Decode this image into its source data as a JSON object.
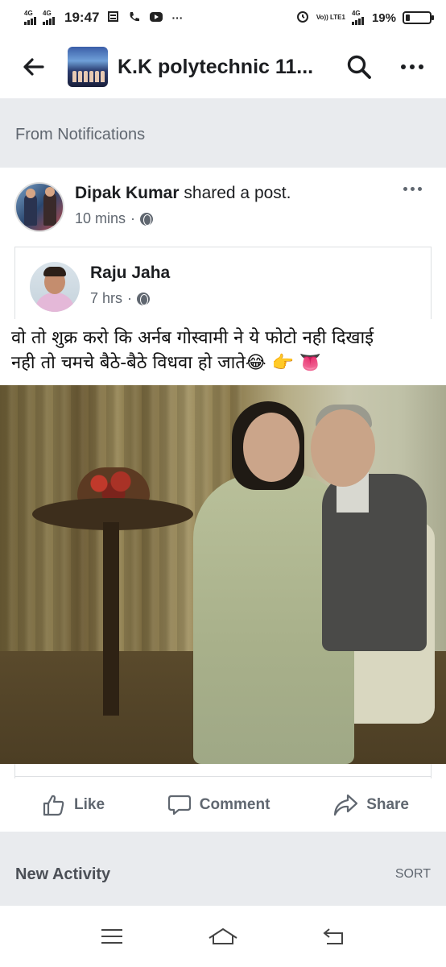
{
  "status_bar": {
    "network_1": "4G",
    "network_2": "4G",
    "time": "19:47",
    "volte": "Vo)) LTE1",
    "network_right": "4G",
    "battery": "19%",
    "battery_level": 0.19
  },
  "header": {
    "title": "K.K polytechnic 11..."
  },
  "notifications": {
    "label": "From Notifications"
  },
  "post": {
    "sharer_name": "Dipak Kumar",
    "action_text": "shared a post.",
    "time": "10 mins",
    "separator": "·",
    "shared": {
      "author": "Raju Jaha",
      "time": "7 hrs",
      "separator": "·",
      "caption_line1": "वो तो शुक्र करो कि अर्नब गोस्वामी ने ये फोटो नही दिखाई",
      "caption_line2": "नही तो चमचे बैठे-बैठे विधवा हो जाते",
      "caption_emojis": "😂 👉 👅"
    }
  },
  "actions": {
    "like": "Like",
    "comment": "Comment",
    "share": "Share"
  },
  "activity": {
    "label": "New Activity",
    "sort": "SORT"
  },
  "icons": {
    "back": "arrow-left-icon",
    "search": "search-icon",
    "more": "more-dots-icon",
    "globe": "globe-icon",
    "like": "thumbs-up-icon",
    "comment": "comment-bubble-icon",
    "share": "share-arrow-icon",
    "menu": "menu-icon",
    "home": "home-icon",
    "back_nav": "back-nav-icon"
  },
  "colors": {
    "text_primary": "#1c1e21",
    "text_secondary": "#606770",
    "band_bg": "#e9ebee"
  }
}
